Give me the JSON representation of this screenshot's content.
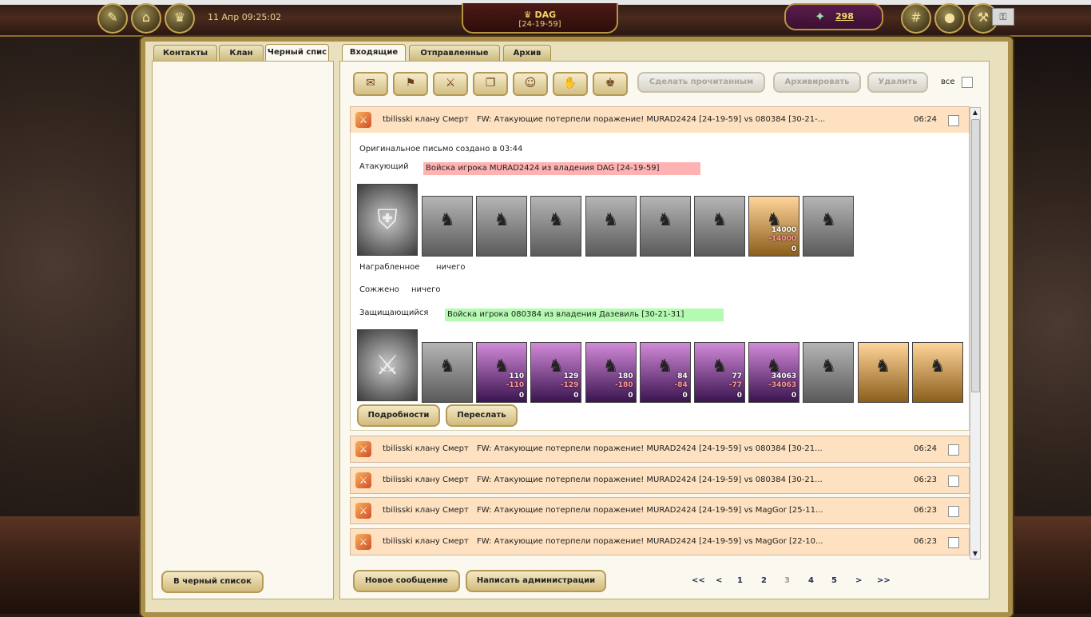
{
  "topbar": {
    "datetime": "11 Апр 09:25:02",
    "domain_name": "DAG",
    "domain_coords": "[24-19-59]",
    "gold": "298",
    "help_icon": "key-icon"
  },
  "left": {
    "tabs": [
      "Контакты",
      "Клан",
      "Черный спис"
    ],
    "active_tab": 2,
    "blacklist_button": "В черный список"
  },
  "right": {
    "tabs": [
      "Входящие",
      "Отправленные",
      "Архив"
    ],
    "active_tab": 0,
    "toolbar": {
      "mark_read": "Сделать прочитанным",
      "archive": "Архивировать",
      "delete": "Удалить",
      "all": "все"
    },
    "expanded": {
      "from": "tbilisski клану Смерт",
      "subject": "FW: Атакующие потерпели поражение! MURAD2424 [24-19-59] vs 080384 [30-21-...",
      "time": "06:24",
      "created": "Оригинальное письмо создано в 03:44",
      "attacker_label": "Атакующий",
      "attacker_troops": "Войска игрока MURAD2424 из владения DAG [24-19-59]",
      "attacker_units": [
        {
          "n1": "",
          "n2": "",
          "n3": ""
        },
        {
          "n1": "",
          "n2": "",
          "n3": ""
        },
        {
          "n1": "",
          "n2": "",
          "n3": ""
        },
        {
          "n1": "",
          "n2": "",
          "n3": ""
        },
        {
          "n1": "",
          "n2": "",
          "n3": ""
        },
        {
          "n1": "",
          "n2": "",
          "n3": ""
        },
        {
          "n1": "14000",
          "n2": "-14000",
          "n3": "0"
        },
        {
          "n1": "",
          "n2": "",
          "n3": ""
        }
      ],
      "looted_label": "Награбленное",
      "looted_value": "ничего",
      "burned_label": "Сожжено",
      "burned_value": "ничего",
      "defender_label": "Защищающийся",
      "defender_troops": "Войска игрока 080384 из владения Дазевиль [30-21-31]",
      "defender_units": [
        {
          "n1": "",
          "n2": "",
          "n3": ""
        },
        {
          "n1": "110",
          "n2": "-110",
          "n3": "0"
        },
        {
          "n1": "129",
          "n2": "-129",
          "n3": "0"
        },
        {
          "n1": "180",
          "n2": "-180",
          "n3": "0"
        },
        {
          "n1": "84",
          "n2": "-84",
          "n3": "0"
        },
        {
          "n1": "77",
          "n2": "-77",
          "n3": "0"
        },
        {
          "n1": "34063",
          "n2": "-34063",
          "n3": "0"
        },
        {
          "n1": "",
          "n2": "",
          "n3": ""
        },
        {
          "n1": "",
          "n2": "",
          "n3": ""
        },
        {
          "n1": "",
          "n2": "",
          "n3": ""
        }
      ],
      "details_button": "Подробности",
      "forward_button": "Переслать"
    },
    "messages": [
      {
        "from": "tbilisski клану Смерт",
        "subject": "FW: Атакующие потерпели поражение! MURAD2424 [24-19-59] vs 080384 [30-21...",
        "time": "06:24"
      },
      {
        "from": "tbilisski клану Смерт",
        "subject": "FW: Атакующие потерпели поражение! MURAD2424 [24-19-59] vs 080384 [30-21...",
        "time": "06:23"
      },
      {
        "from": "tbilisski клану Смерт",
        "subject": "FW: Атакующие потерпели поражение! MURAD2424 [24-19-59] vs MagGor [25-11...",
        "time": "06:23"
      },
      {
        "from": "tbilisski клану Смерт",
        "subject": "FW: Атакующие потерпели поражение! MURAD2424 [24-19-59] vs MagGor [22-10...",
        "time": "06:23"
      }
    ],
    "new_message_button": "Новое сообщение",
    "write_admin_button": "Написать администрации",
    "pager": {
      "first": "<<",
      "prev": "<",
      "pages": [
        "1",
        "2",
        "3",
        "4",
        "5"
      ],
      "current": "3",
      "next": ">",
      "last": ">>"
    }
  }
}
